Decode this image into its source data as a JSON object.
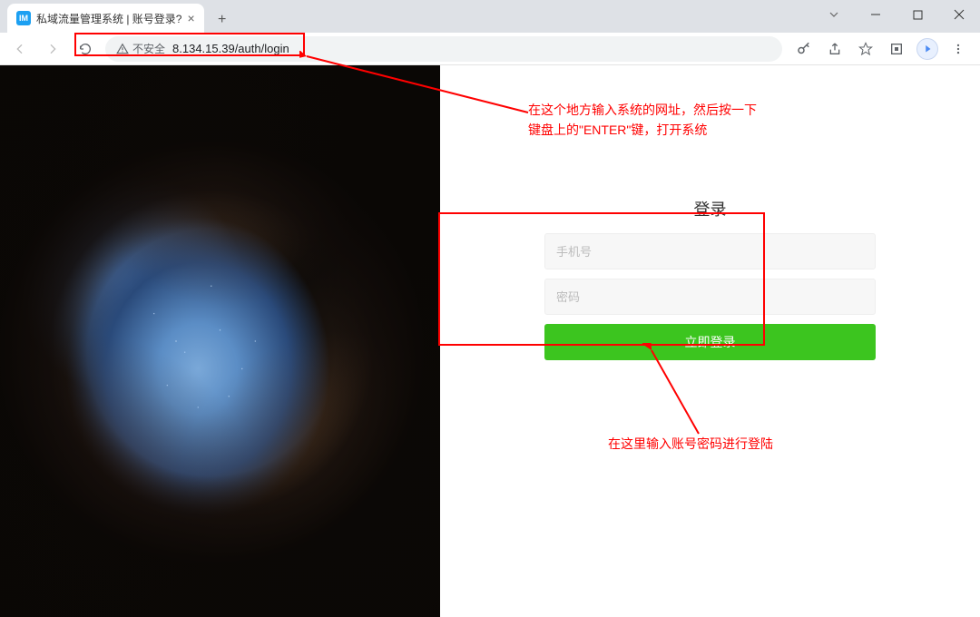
{
  "window": {
    "tab_title": "私域流量管理系统 | 账号登录?",
    "favicon_text": "IM"
  },
  "toolbar": {
    "security_label": "不安全",
    "url": "8.134.15.39/auth/login"
  },
  "login": {
    "title": "登录",
    "phone_placeholder": "手机号",
    "password_placeholder": "密码",
    "submit_label": "立即登录"
  },
  "annotations": {
    "url_hint_line1": "在这个地方输入系统的网址，然后按一下",
    "url_hint_line2": "键盘上的\"ENTER\"键，打开系统",
    "form_hint": "在这里输入账号密码进行登陆"
  },
  "colors": {
    "accent_green": "#3cc51f",
    "annotation_red": "#ff0000"
  }
}
